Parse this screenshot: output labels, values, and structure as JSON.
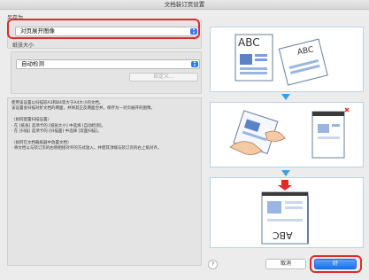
{
  "window": {
    "title": "文档装订页设置"
  },
  "save_as": {
    "label": "另存为",
    "selected": "对页展开图像"
  },
  "paper_size": {
    "label": "纸张大小",
    "selected": "自动检测",
    "custom_button": "自定义..."
  },
  "description": {
    "lines": [
      "使用该设置以扫描较A3和B4等大于A4大小的文档。",
      "该设置会扫描对折文档的两面，并将其正反两面合并，保存为一对页展开的图像。",
      "",
      "〈如何配置扫描设置〉",
      "· 在 [纸张] 选项卡的 [纸张大小] 中选择 [自动检测]。",
      "· 在 [扫描] 选项卡的 [扫描面] 中选择 [双面扫描]。",
      "",
      "〈如何在文档载纸器中放置文档〉",
      "· 将文档以与装订页的右侧相接对齐的方式放入，并使其顶端与装订页的右上角对齐。"
    ]
  },
  "illustration": {
    "step1_text_left": "ABC",
    "step1_text_right": "ABC",
    "step3_text": "ABC"
  },
  "footer": {
    "help": "?",
    "cancel": "取消",
    "ok": "好"
  },
  "colors": {
    "accent": "#1a73ec",
    "highlight": "#e12a2a",
    "arrow": "#3ba0e0"
  }
}
